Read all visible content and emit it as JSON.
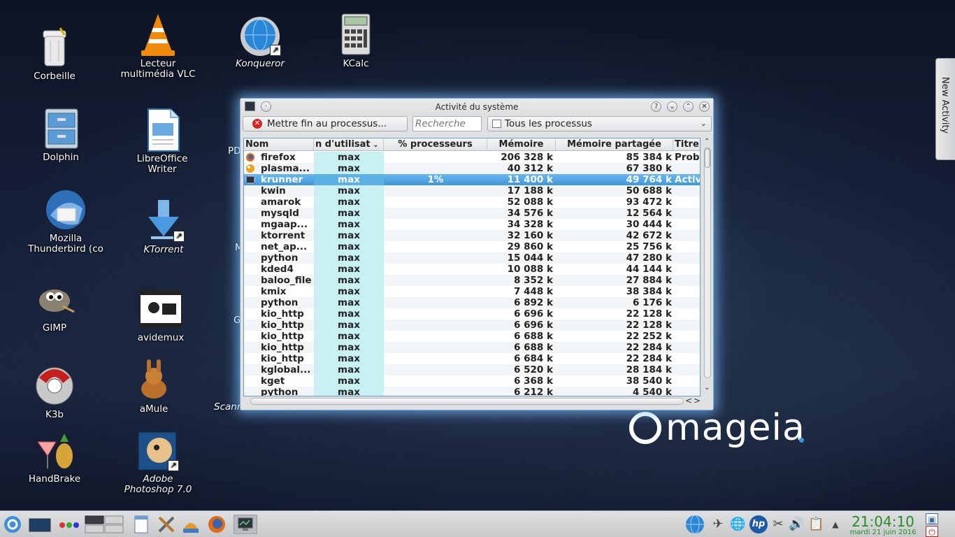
{
  "desktop_icons": [
    {
      "label": "Corbeille",
      "icon": "trash-icon"
    },
    {
      "label": "Dolphin",
      "icon": "file-manager-icon"
    },
    {
      "label": "Mozilla\nThunderbird (co",
      "icon": "thunderbird-icon"
    },
    {
      "label": "GIMP",
      "icon": "gimp-icon"
    },
    {
      "label": "K3b",
      "icon": "k3b-icon"
    },
    {
      "label": "HandBrake",
      "icon": "handbrake-icon"
    },
    {
      "label": "Lecteur\nmultimédia VLC",
      "icon": "vlc-icon"
    },
    {
      "label": "LibreOffice\nWriter",
      "icon": "writer-icon"
    },
    {
      "label": "KTorrent",
      "icon": "ktorrent-icon"
    },
    {
      "label": "avidemux",
      "icon": "avidemux-icon"
    },
    {
      "label": "aMule",
      "icon": "amule-icon"
    },
    {
      "label": "Adobe\nPhotoshop 7.0",
      "icon": "photoshop-icon"
    },
    {
      "label": "Konqueror",
      "icon": "konqueror-icon"
    },
    {
      "label": "KCalc",
      "icon": "calculator-icon"
    }
  ],
  "partial_labels": [
    "PD",
    "M",
    "G",
    "Scann"
  ],
  "new_activity": "New Activity",
  "brand": "mageia",
  "window": {
    "title": "Activité du système",
    "toolbar": {
      "kill_label": "Mettre fin au processus...",
      "search_placeholder": "Recherche",
      "filter_value": "Tous les processus"
    },
    "columns": [
      "Nom",
      "n d'utilisat",
      "% processeurs",
      "Mémoire",
      "Mémoire partagée",
      "Titre"
    ],
    "rows": [
      {
        "name": "firefox",
        "user": "max",
        "cpu": "",
        "mem": "206 328 k",
        "shared": "85 384 k",
        "title": "Probl",
        "icon": "firefox-icon"
      },
      {
        "name": "plasma...",
        "user": "max",
        "cpu": "",
        "mem": "40 312 k",
        "shared": "67 380 k",
        "title": "",
        "icon": "plasma-icon"
      },
      {
        "name": "krunner",
        "user": "max",
        "cpu": "1%",
        "mem": "11 400 k",
        "shared": "49 764 k",
        "title": "Activ",
        "icon": "window-icon"
      },
      {
        "name": "kwin",
        "user": "max",
        "cpu": "",
        "mem": "17 188 k",
        "shared": "50 688 k",
        "title": ""
      },
      {
        "name": "amarok",
        "user": "max",
        "cpu": "",
        "mem": "52 088 k",
        "shared": "93 472 k",
        "title": ""
      },
      {
        "name": "mysqld",
        "user": "max",
        "cpu": "",
        "mem": "34 576 k",
        "shared": "12 564 k",
        "title": ""
      },
      {
        "name": "mgaap...",
        "user": "max",
        "cpu": "",
        "mem": "34 328 k",
        "shared": "30 444 k",
        "title": ""
      },
      {
        "name": "ktorrent",
        "user": "max",
        "cpu": "",
        "mem": "32 160 k",
        "shared": "42 672 k",
        "title": ""
      },
      {
        "name": "net_ap...",
        "user": "max",
        "cpu": "",
        "mem": "29 860 k",
        "shared": "25 756 k",
        "title": ""
      },
      {
        "name": "python",
        "user": "max",
        "cpu": "",
        "mem": "15 044 k",
        "shared": "47 280 k",
        "title": ""
      },
      {
        "name": "kded4",
        "user": "max",
        "cpu": "",
        "mem": "10 088 k",
        "shared": "44 144 k",
        "title": ""
      },
      {
        "name": "baloo_file",
        "user": "max",
        "cpu": "",
        "mem": "8 352 k",
        "shared": "27 884 k",
        "title": ""
      },
      {
        "name": "kmix",
        "user": "max",
        "cpu": "",
        "mem": "7 448 k",
        "shared": "38 384 k",
        "title": ""
      },
      {
        "name": "python",
        "user": "max",
        "cpu": "",
        "mem": "6 892 k",
        "shared": "6 176 k",
        "title": ""
      },
      {
        "name": "kio_http",
        "user": "max",
        "cpu": "",
        "mem": "6 696 k",
        "shared": "22 128 k",
        "title": ""
      },
      {
        "name": "kio_http",
        "user": "max",
        "cpu": "",
        "mem": "6 696 k",
        "shared": "22 128 k",
        "title": ""
      },
      {
        "name": "kio_http",
        "user": "max",
        "cpu": "",
        "mem": "6 688 k",
        "shared": "22 252 k",
        "title": ""
      },
      {
        "name": "kio_http",
        "user": "max",
        "cpu": "",
        "mem": "6 688 k",
        "shared": "22 284 k",
        "title": ""
      },
      {
        "name": "kio_http",
        "user": "max",
        "cpu": "",
        "mem": "6 684 k",
        "shared": "22 284 k",
        "title": ""
      },
      {
        "name": "kglobal...",
        "user": "max",
        "cpu": "",
        "mem": "6 520 k",
        "shared": "28 184 k",
        "title": ""
      },
      {
        "name": "kget",
        "user": "max",
        "cpu": "",
        "mem": "6 368 k",
        "shared": "38 540 k",
        "title": ""
      },
      {
        "name": "python",
        "user": "max",
        "cpu": "",
        "mem": "6 212 k",
        "shared": "4 540 k",
        "title": ""
      }
    ]
  },
  "taskbar": {
    "time": "21:04:10",
    "date": "mardi 21 juin 2016",
    "tray_icons": [
      "network-globe-icon",
      "paper-plane-icon",
      "globe-icon",
      "hp-icon",
      "scissors-icon",
      "volume-icon",
      "clipboard-icon",
      "expand-arrow-icon"
    ]
  },
  "colors": {
    "selection": "#3f98da",
    "user_column": "#c9f0f2",
    "clock": "#2a8a2a",
    "window_glow": "#78beff"
  }
}
